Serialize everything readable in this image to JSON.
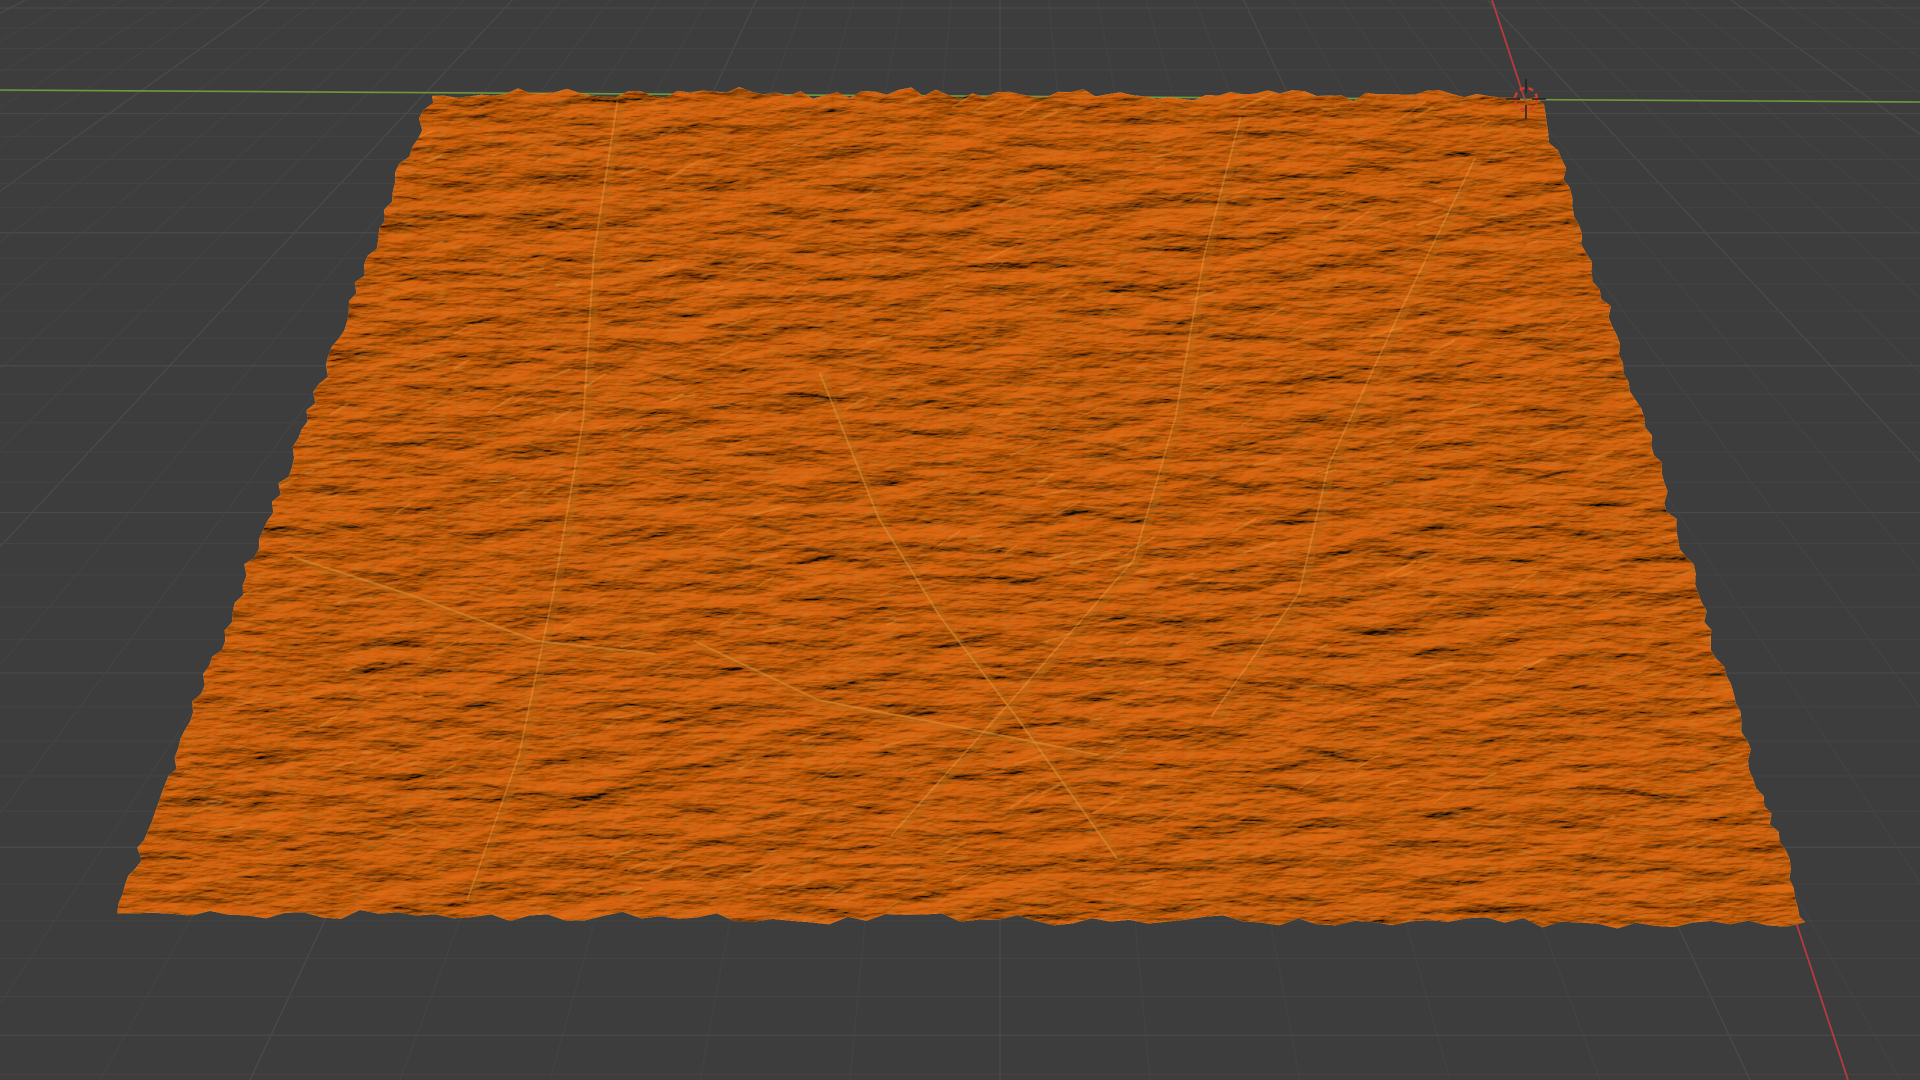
{
  "viewport": {
    "mode": "3D Viewport",
    "background_color": "#3d3d3d",
    "grid_color": "#4a4a4a",
    "grid_minor_color": "#444444",
    "x_axis_color": "#b8393f",
    "y_axis_color": "#6e9a3a"
  },
  "terrain_object": {
    "type": "mesh",
    "selected": true,
    "selection_color": "#e8962f",
    "shade_dark": "#b86a18",
    "shade_light": "#f3aa48"
  },
  "cursor_3d": {
    "icon": "crosshair-cursor-icon",
    "ring_color_a": "#d33b2c",
    "ring_color_b": "#ffffff"
  }
}
